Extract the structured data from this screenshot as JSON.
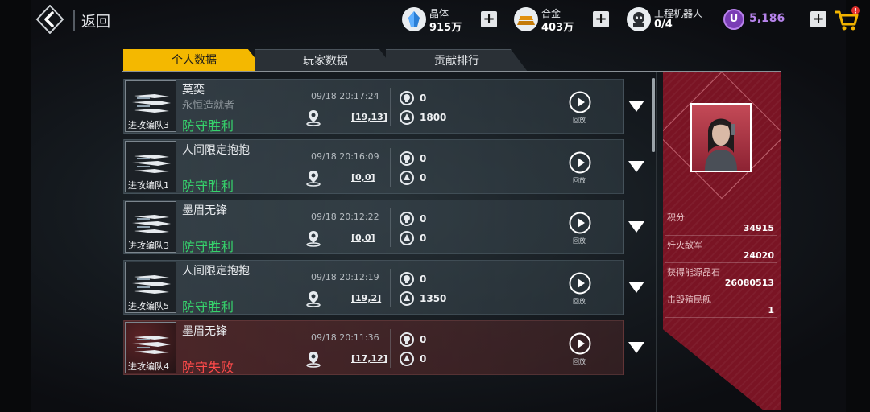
{
  "header": {
    "back_label": "返回",
    "resources": [
      {
        "name": "晶体",
        "value": "915万",
        "icon": "crystal-icon"
      },
      {
        "name": "合金",
        "value": "403万",
        "icon": "alloy-icon"
      },
      {
        "name": "工程机器人",
        "value": "0/4",
        "icon": "robot-icon"
      }
    ],
    "premium": {
      "icon_letter": "U",
      "value": "5,186"
    },
    "cart_badge": "!"
  },
  "tabs": [
    {
      "label": "个人数据",
      "active": true
    },
    {
      "label": "玩家数据",
      "active": false
    },
    {
      "label": "贡献排行",
      "active": false
    }
  ],
  "records": [
    {
      "team": "进攻编队3",
      "name": "莫奕",
      "title": "永恒造就者",
      "result": "防守胜利",
      "win": true,
      "time": "09/18 20:17:24",
      "coord": "[19,13]",
      "stat1": "0",
      "stat2": "1800",
      "replay_label": "回放"
    },
    {
      "team": "进攻编队1",
      "name": "人间限定抱抱",
      "title": "",
      "result": "防守胜利",
      "win": true,
      "time": "09/18 20:16:09",
      "coord": "[0,0]",
      "stat1": "0",
      "stat2": "0",
      "replay_label": "回放"
    },
    {
      "team": "进攻编队3",
      "name": "墨眉无锋",
      "title": "",
      "result": "防守胜利",
      "win": true,
      "time": "09/18 20:12:22",
      "coord": "[0,0]",
      "stat1": "0",
      "stat2": "0",
      "replay_label": "回放"
    },
    {
      "team": "进攻编队5",
      "name": "人间限定抱抱",
      "title": "",
      "result": "防守胜利",
      "win": true,
      "time": "09/18 20:12:19",
      "coord": "[19,2]",
      "stat1": "0",
      "stat2": "1350",
      "replay_label": "回放"
    },
    {
      "team": "进攻编队4",
      "name": "墨眉无锋",
      "title": "",
      "result": "防守失败",
      "win": false,
      "time": "09/18 20:11:36",
      "coord": "[17,12]",
      "stat1": "0",
      "stat2": "0",
      "replay_label": "回放"
    }
  ],
  "stats": [
    {
      "label": "积分",
      "value": "34915"
    },
    {
      "label": "歼灭敌军",
      "value": "24020"
    },
    {
      "label": "获得能源晶石",
      "value": "26080513"
    },
    {
      "label": "击毁殖民舰",
      "value": "1"
    }
  ],
  "colors": {
    "accent": "#f4b800",
    "win": "#36d36c",
    "lose": "#ff4a4a",
    "panel": "#7a1424",
    "premium": "#b683ea"
  }
}
